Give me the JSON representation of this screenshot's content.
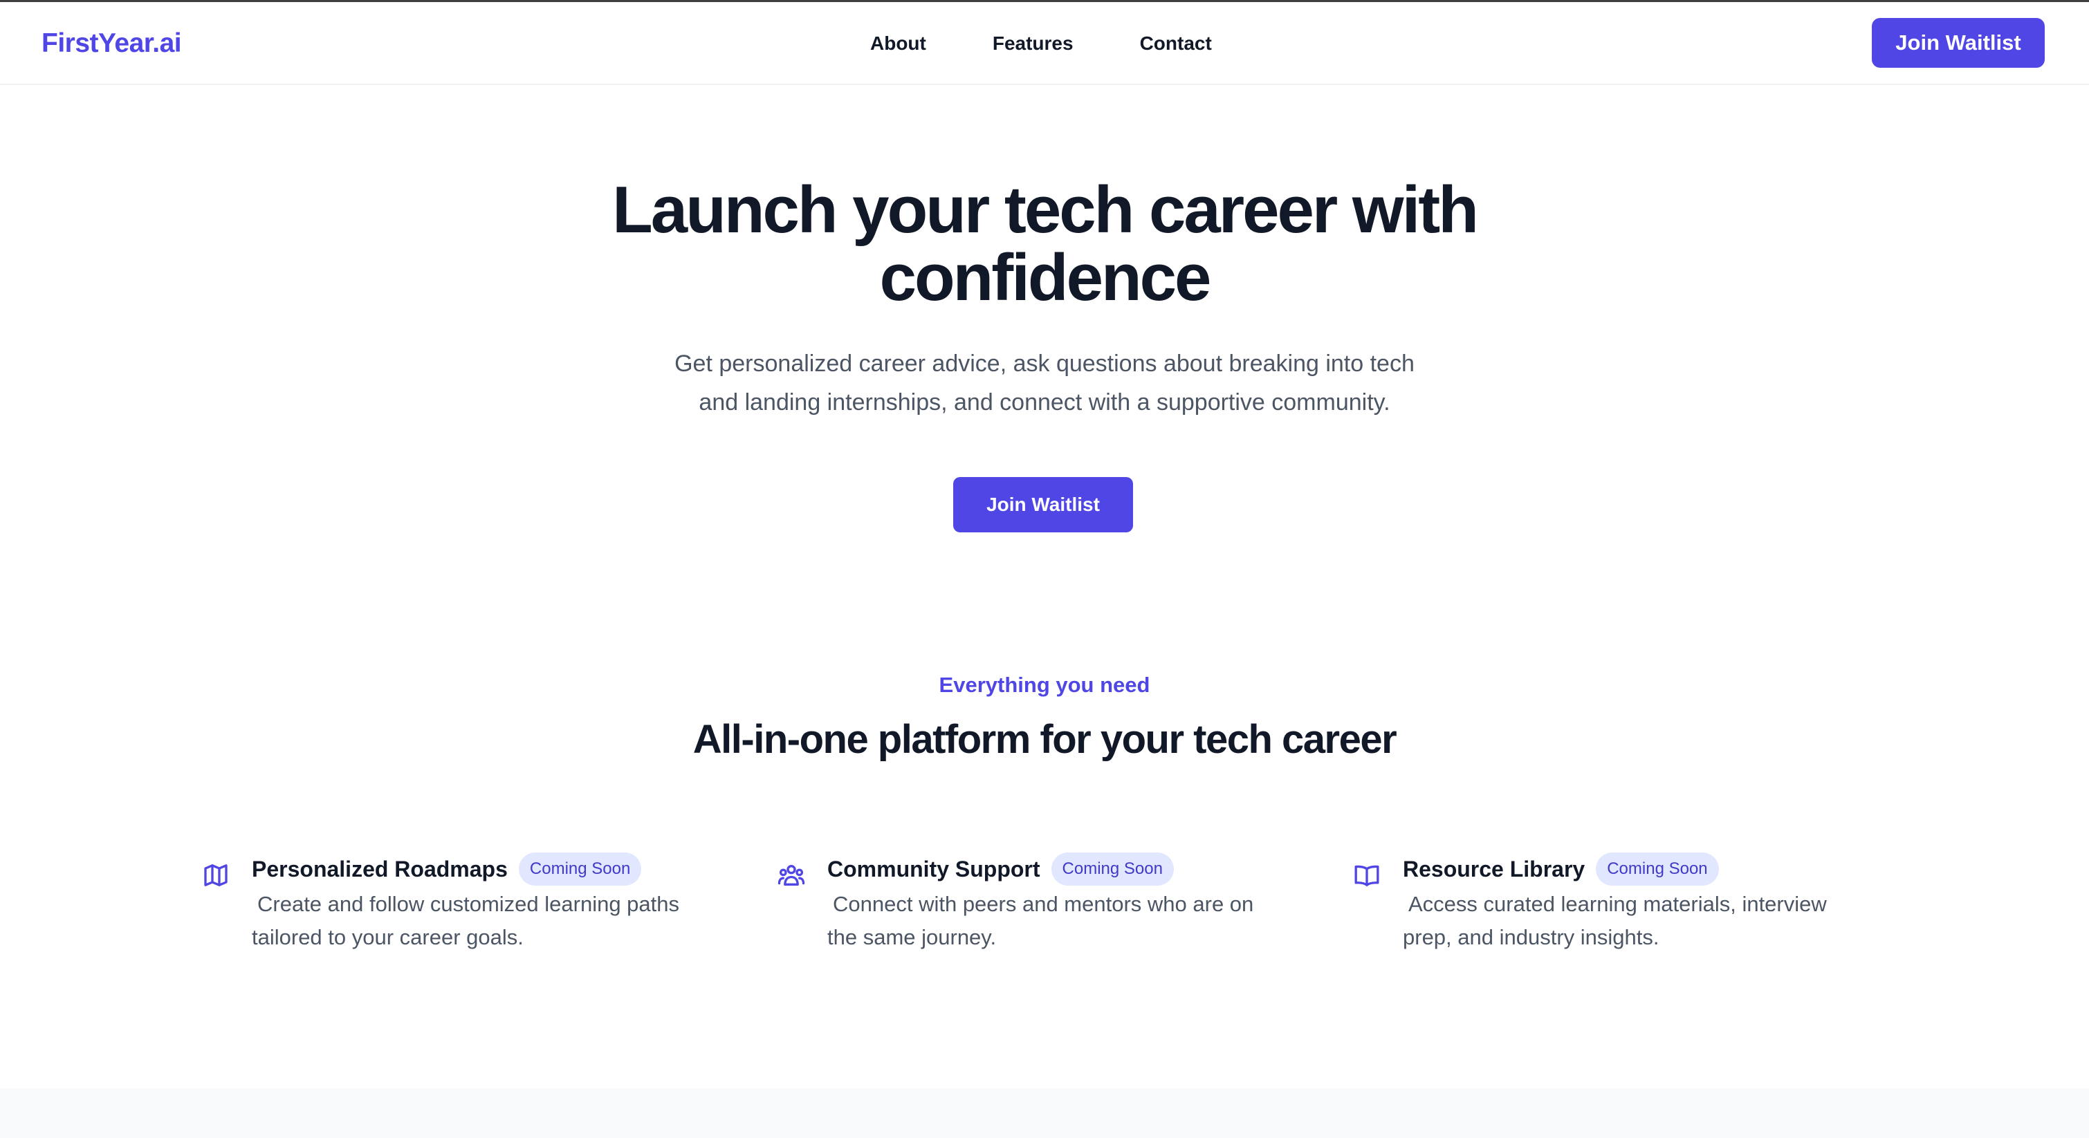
{
  "brand": {
    "name": "FirstYear.ai",
    "accent_color": "#4f46e5"
  },
  "nav": {
    "links": [
      "About",
      "Features",
      "Contact"
    ],
    "cta_label": "Join Waitlist"
  },
  "hero": {
    "title_line1": "Launch your tech career with",
    "title_line2": "confidence",
    "subtitle_line1": "Get personalized career advice, ask questions about breaking into tech",
    "subtitle_line2": "and landing internships, and connect with a supportive community.",
    "cta_label": "Join Waitlist"
  },
  "features_section": {
    "eyebrow": "Everything you need",
    "title": "All-in-one platform for your tech career",
    "items": [
      {
        "icon": "map-icon",
        "title": "Personalized Roadmaps",
        "badge": "Coming Soon",
        "desc_line1": "Create and follow customized learning paths",
        "desc_line2": "tailored to your career goals."
      },
      {
        "icon": "users-icon",
        "title": "Community Support",
        "badge": "Coming Soon",
        "desc_line1": "Connect with peers and mentors who are on",
        "desc_line2": "the same journey."
      },
      {
        "icon": "book-open-icon",
        "title": "Resource Library",
        "badge": "Coming Soon",
        "desc_line1": "Access curated learning materials, interview",
        "desc_line2": "prep, and industry insights."
      }
    ]
  }
}
